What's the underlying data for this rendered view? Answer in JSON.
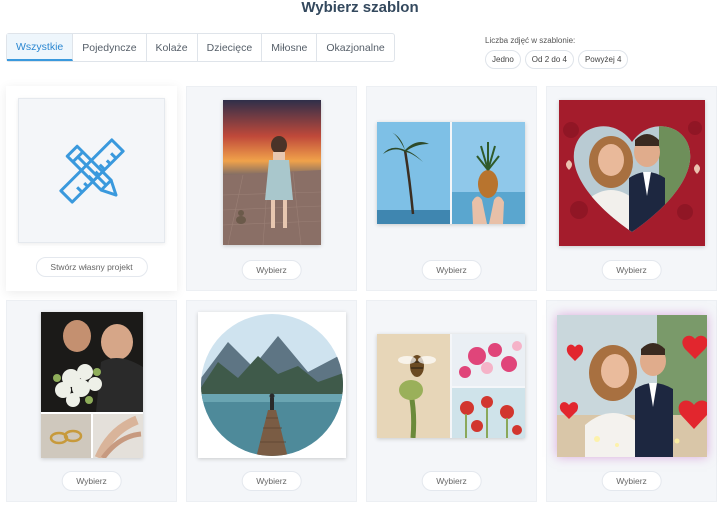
{
  "header": {
    "title": "Wybierz szablon"
  },
  "tabs": [
    {
      "label": "Wszystkie",
      "active": true
    },
    {
      "label": "Pojedyncze",
      "active": false
    },
    {
      "label": "Kolaże",
      "active": false
    },
    {
      "label": "Dziecięce",
      "active": false
    },
    {
      "label": "Miłosne",
      "active": false
    },
    {
      "label": "Okazjonalne",
      "active": false
    }
  ],
  "photo_count": {
    "label": "Liczba zdjęć w szablonie:",
    "options": [
      "Jedno",
      "Od 2 do 4",
      "Powyżej 4"
    ]
  },
  "cards": [
    {
      "button": "Stwórz własny projekt",
      "icon": "pencil-ruler-icon"
    },
    {
      "button": "Wybierz"
    },
    {
      "button": "Wybierz"
    },
    {
      "button": "Wybierz"
    },
    {
      "button": "Wybierz"
    },
    {
      "button": "Wybierz"
    },
    {
      "button": "Wybierz"
    },
    {
      "button": "Wybierz"
    }
  ],
  "colors": {
    "accent": "#3a99dd",
    "heart_red": "#a41c2c"
  }
}
